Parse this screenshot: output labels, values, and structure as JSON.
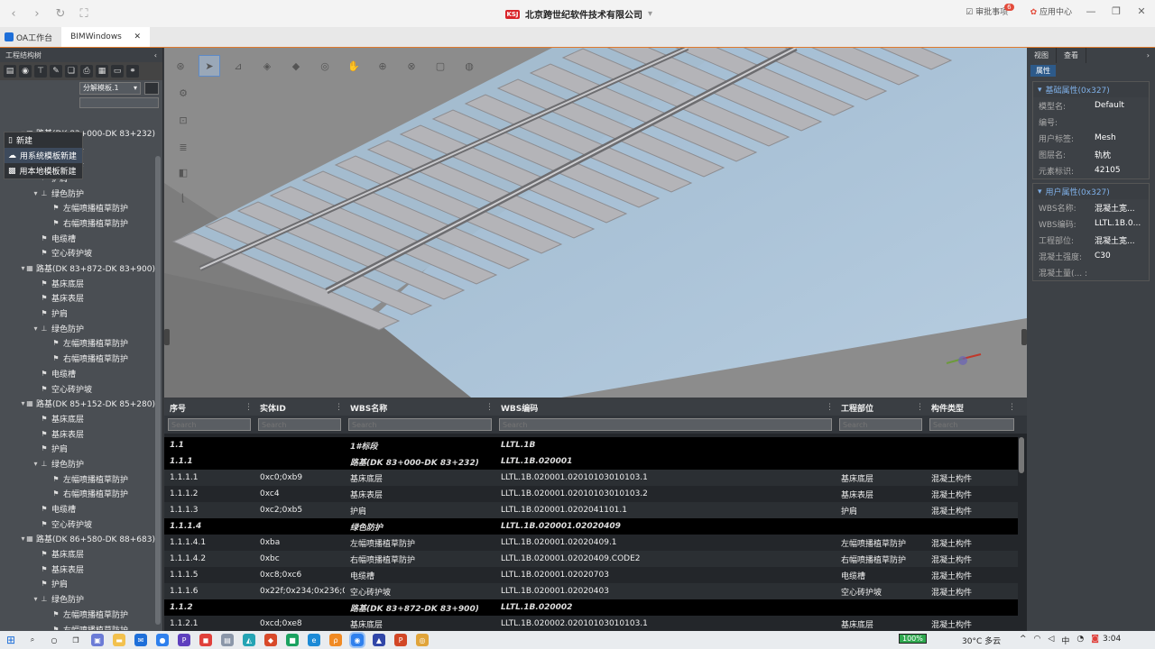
{
  "browser": {
    "company_title": "北京跨世纪软件技术有限公司",
    "logo_text": "KSJ",
    "approvals_label": "审批事项",
    "approvals_count": "6",
    "app_center_label": "应用中心",
    "tabs": [
      {
        "label": "OA工作台"
      },
      {
        "label": "BIMWindows"
      }
    ]
  },
  "left_panel": {
    "title": "工程结构树",
    "template_select": "分解模板.1",
    "context_menu": [
      "新建",
      "用系统模板新建",
      "用本地模板新建"
    ],
    "tree": [
      {
        "level": 1,
        "caret": "▾",
        "icon": "▦",
        "label": "路基(DK 83+000-DK 83+232)"
      },
      {
        "level": 2,
        "caret": "",
        "icon": "⚑",
        "label": "基床底层"
      },
      {
        "level": 2,
        "caret": "",
        "icon": "⚑",
        "label": "基床表层"
      },
      {
        "level": 2,
        "caret": "",
        "icon": "⚑",
        "label": "护肩"
      },
      {
        "level": 2,
        "caret": "▾",
        "icon": "⊥",
        "label": "绿色防护"
      },
      {
        "level": 3,
        "caret": "",
        "icon": "⚑",
        "label": "左幅喷播植草防护"
      },
      {
        "level": 3,
        "caret": "",
        "icon": "⚑",
        "label": "右幅喷播植草防护"
      },
      {
        "level": 2,
        "caret": "",
        "icon": "⚑",
        "label": "电缆槽"
      },
      {
        "level": 2,
        "caret": "",
        "icon": "⚑",
        "label": "空心砖护坡"
      },
      {
        "level": 1,
        "caret": "▾",
        "icon": "▦",
        "label": "路基(DK 83+872-DK 83+900)"
      },
      {
        "level": 2,
        "caret": "",
        "icon": "⚑",
        "label": "基床底层"
      },
      {
        "level": 2,
        "caret": "",
        "icon": "⚑",
        "label": "基床表层"
      },
      {
        "level": 2,
        "caret": "",
        "icon": "⚑",
        "label": "护肩"
      },
      {
        "level": 2,
        "caret": "▾",
        "icon": "⊥",
        "label": "绿色防护"
      },
      {
        "level": 3,
        "caret": "",
        "icon": "⚑",
        "label": "左幅喷播植草防护"
      },
      {
        "level": 3,
        "caret": "",
        "icon": "⚑",
        "label": "右幅喷播植草防护"
      },
      {
        "level": 2,
        "caret": "",
        "icon": "⚑",
        "label": "电缆槽"
      },
      {
        "level": 2,
        "caret": "",
        "icon": "⚑",
        "label": "空心砖护坡"
      },
      {
        "level": 1,
        "caret": "▾",
        "icon": "▦",
        "label": "路基(DK 85+152-DK 85+280)"
      },
      {
        "level": 2,
        "caret": "",
        "icon": "⚑",
        "label": "基床底层"
      },
      {
        "level": 2,
        "caret": "",
        "icon": "⚑",
        "label": "基床表层"
      },
      {
        "level": 2,
        "caret": "",
        "icon": "⚑",
        "label": "护肩"
      },
      {
        "level": 2,
        "caret": "▾",
        "icon": "⊥",
        "label": "绿色防护"
      },
      {
        "level": 3,
        "caret": "",
        "icon": "⚑",
        "label": "左幅喷播植草防护"
      },
      {
        "level": 3,
        "caret": "",
        "icon": "⚑",
        "label": "右幅喷播植草防护"
      },
      {
        "level": 2,
        "caret": "",
        "icon": "⚑",
        "label": "电缆槽"
      },
      {
        "level": 2,
        "caret": "",
        "icon": "⚑",
        "label": "空心砖护坡"
      },
      {
        "level": 1,
        "caret": "▾",
        "icon": "▦",
        "label": "路基(DK 86+580-DK 88+683)"
      },
      {
        "level": 2,
        "caret": "",
        "icon": "⚑",
        "label": "基床底层"
      },
      {
        "level": 2,
        "caret": "",
        "icon": "⚑",
        "label": "基床表层"
      },
      {
        "level": 2,
        "caret": "",
        "icon": "⚑",
        "label": "护肩"
      },
      {
        "level": 2,
        "caret": "▾",
        "icon": "⊥",
        "label": "绿色防护"
      },
      {
        "level": 3,
        "caret": "",
        "icon": "⚑",
        "label": "左幅喷播植草防护"
      },
      {
        "level": 3,
        "caret": "",
        "icon": "⚑",
        "label": "右幅喷播植草防护"
      }
    ]
  },
  "right_panel": {
    "tabs": [
      "视图",
      "查看"
    ],
    "subtab": "属性",
    "basic_group_title": "基础属性(0x327)",
    "basic_props": [
      {
        "key": "模型名:",
        "value": "Default"
      },
      {
        "key": "编号:",
        "value": ""
      },
      {
        "key": "用户标签:",
        "value": "Mesh"
      },
      {
        "key": "图层名:",
        "value": "轨枕"
      },
      {
        "key": "元素标识:",
        "value": "42105"
      }
    ],
    "user_group_title": "用户属性(0x327)",
    "user_props": [
      {
        "key": "WBS名称:",
        "value": "混凝土宽..."
      },
      {
        "key": "WBS编码:",
        "value": "LLTL.1B.0..."
      },
      {
        "key": "工程部位:",
        "value": "混凝土宽..."
      },
      {
        "key": "混凝土强度:",
        "value": "C30"
      },
      {
        "key": "混凝土量(... :",
        "value": ""
      }
    ]
  },
  "table": {
    "columns": [
      "序号",
      "实体ID",
      "WBS名称",
      "WBS编码",
      "工程部位",
      "构件类型"
    ],
    "search_placeholder": "Search",
    "rows": [
      {
        "group": true,
        "cells": [
          "1.1",
          "",
          "1#标段",
          "LLTL.1B",
          "",
          ""
        ]
      },
      {
        "group": true,
        "cells": [
          "1.1.1",
          "",
          "路基(DK 83+000-DK 83+232)",
          "LLTL.1B.020001",
          "",
          ""
        ]
      },
      {
        "group": false,
        "cells": [
          "1.1.1.1",
          "0xc0;0xb9",
          "基床底层",
          "LLTL.1B.020001.02010103010103.1",
          "基床底层",
          "混凝土构件"
        ]
      },
      {
        "group": false,
        "cells": [
          "1.1.1.2",
          "0xc4",
          "基床表层",
          "LLTL.1B.020001.02010103010103.2",
          "基床表层",
          "混凝土构件"
        ]
      },
      {
        "group": false,
        "cells": [
          "1.1.1.3",
          "0xc2;0xb5",
          "护肩",
          "LLTL.1B.020001.0202041101.1",
          "护肩",
          "混凝土构件"
        ]
      },
      {
        "group": true,
        "cells": [
          "1.1.1.4",
          "",
          "绿色防护",
          "LLTL.1B.020001.02020409",
          "",
          ""
        ]
      },
      {
        "group": false,
        "cells": [
          "1.1.1.4.1",
          "0xba",
          "左幅喷播植草防护",
          "LLTL.1B.020001.02020409.1",
          "左幅喷播植草防护",
          "混凝土构件"
        ]
      },
      {
        "group": false,
        "cells": [
          "1.1.1.4.2",
          "0xbc",
          "右幅喷播植草防护",
          "LLTL.1B.020001.02020409.CODE2",
          "右幅喷播植草防护",
          "混凝土构件"
        ]
      },
      {
        "group": false,
        "cells": [
          "1.1.1.5",
          "0xc8;0xc6",
          "电缆槽",
          "LLTL.1B.020001.02020703",
          "电缆槽",
          "混凝土构件"
        ]
      },
      {
        "group": false,
        "cells": [
          "1.1.1.6",
          "0x22f;0x234;0x236;0x",
          "空心砖护坡",
          "LLTL.1B.020001.02020403",
          "空心砖护坡",
          "混凝土构件"
        ]
      },
      {
        "group": true,
        "cells": [
          "1.1.2",
          "",
          "路基(DK 83+872-DK 83+900)",
          "LLTL.1B.020002",
          "",
          ""
        ]
      },
      {
        "group": false,
        "cells": [
          "1.1.2.1",
          "0xcd;0xe8",
          "基床底层",
          "LLTL.1B.020002.02010103010103.1",
          "基床底层",
          "混凝土构件"
        ]
      }
    ]
  },
  "taskbar": {
    "battery": "100%",
    "weather": "30°C 多云",
    "time": "3:04"
  },
  "colors": {
    "accent_orange": "#e07a2c",
    "panel_bg": "#4a4e53",
    "rail_blue": "#a9c3d8",
    "sleeper_gray": "#b4b4b8"
  }
}
